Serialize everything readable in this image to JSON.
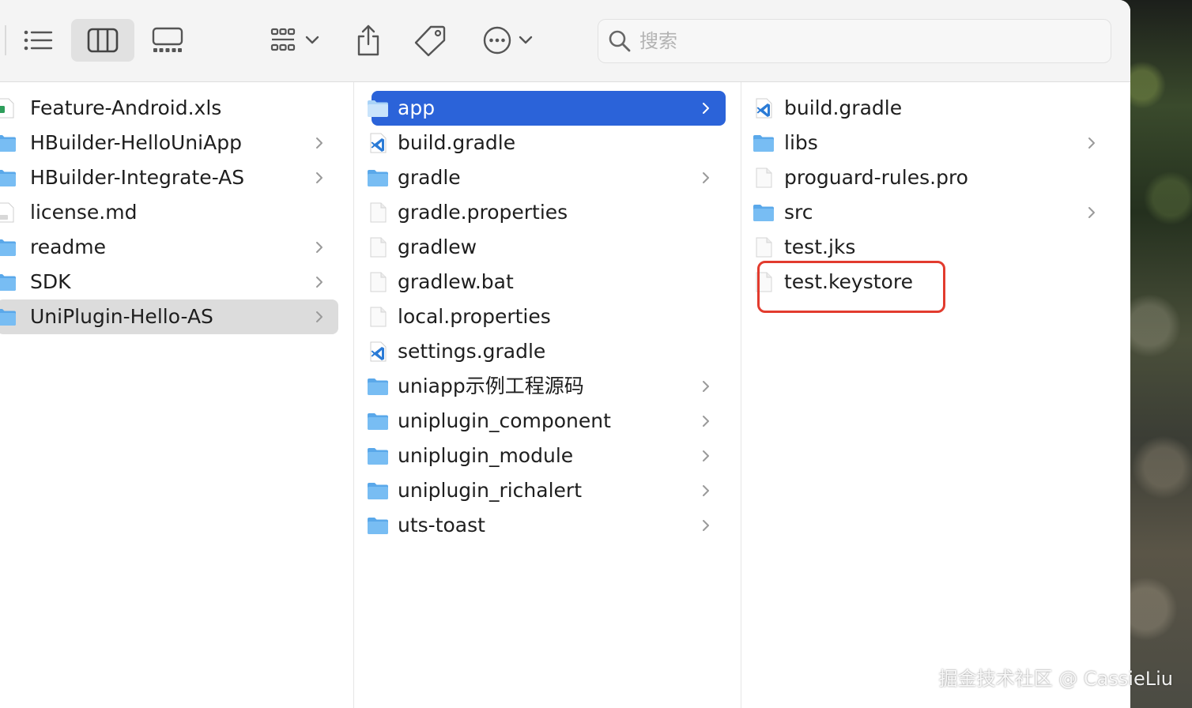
{
  "search": {
    "placeholder": "搜索"
  },
  "columns": [
    {
      "items": [
        {
          "name": "Feature-Android.xls",
          "kind": "xls",
          "chevron": false
        },
        {
          "name": "HBuilder-HelloUniApp",
          "kind": "folder",
          "chevron": true
        },
        {
          "name": "HBuilder-Integrate-AS",
          "kind": "folder",
          "chevron": true
        },
        {
          "name": "license.md",
          "kind": "md",
          "chevron": false
        },
        {
          "name": "readme",
          "kind": "folder",
          "chevron": true
        },
        {
          "name": "SDK",
          "kind": "folder",
          "chevron": true
        },
        {
          "name": "UniPlugin-Hello-AS",
          "kind": "folder",
          "chevron": true,
          "selected": "gray"
        }
      ]
    },
    {
      "items": [
        {
          "name": "app",
          "kind": "folder",
          "chevron": true,
          "selected": "blue"
        },
        {
          "name": "build.gradle",
          "kind": "vscode",
          "chevron": false
        },
        {
          "name": "gradle",
          "kind": "folder",
          "chevron": true
        },
        {
          "name": "gradle.properties",
          "kind": "file",
          "chevron": false
        },
        {
          "name": "gradlew",
          "kind": "file",
          "chevron": false
        },
        {
          "name": "gradlew.bat",
          "kind": "file",
          "chevron": false
        },
        {
          "name": "local.properties",
          "kind": "file",
          "chevron": false
        },
        {
          "name": "settings.gradle",
          "kind": "vscode",
          "chevron": false
        },
        {
          "name": "uniapp示例工程源码",
          "kind": "folder",
          "chevron": true
        },
        {
          "name": "uniplugin_component",
          "kind": "folder",
          "chevron": true
        },
        {
          "name": "uniplugin_module",
          "kind": "folder",
          "chevron": true
        },
        {
          "name": "uniplugin_richalert",
          "kind": "folder",
          "chevron": true
        },
        {
          "name": "uts-toast",
          "kind": "folder",
          "chevron": true
        }
      ]
    },
    {
      "items": [
        {
          "name": "build.gradle",
          "kind": "vscode",
          "chevron": false
        },
        {
          "name": "libs",
          "kind": "folder",
          "chevron": true
        },
        {
          "name": "proguard-rules.pro",
          "kind": "file",
          "chevron": false
        },
        {
          "name": "src",
          "kind": "folder",
          "chevron": true
        },
        {
          "name": "test.jks",
          "kind": "file",
          "chevron": false
        },
        {
          "name": "test.keystore",
          "kind": "file",
          "chevron": false,
          "highlighted": true
        }
      ]
    }
  ],
  "watermark": "掘金技术社区 @ CassieLiu",
  "colors": {
    "accent": "#2b63d9",
    "folder": "#6cb6f2",
    "highlight": "#e23b2e"
  },
  "icons": {
    "toolbar": [
      "list-view-icon",
      "column-view-icon",
      "gallery-view-icon",
      "group-icon",
      "share-icon",
      "tag-icon",
      "more-actions-icon",
      "search-icon"
    ]
  }
}
